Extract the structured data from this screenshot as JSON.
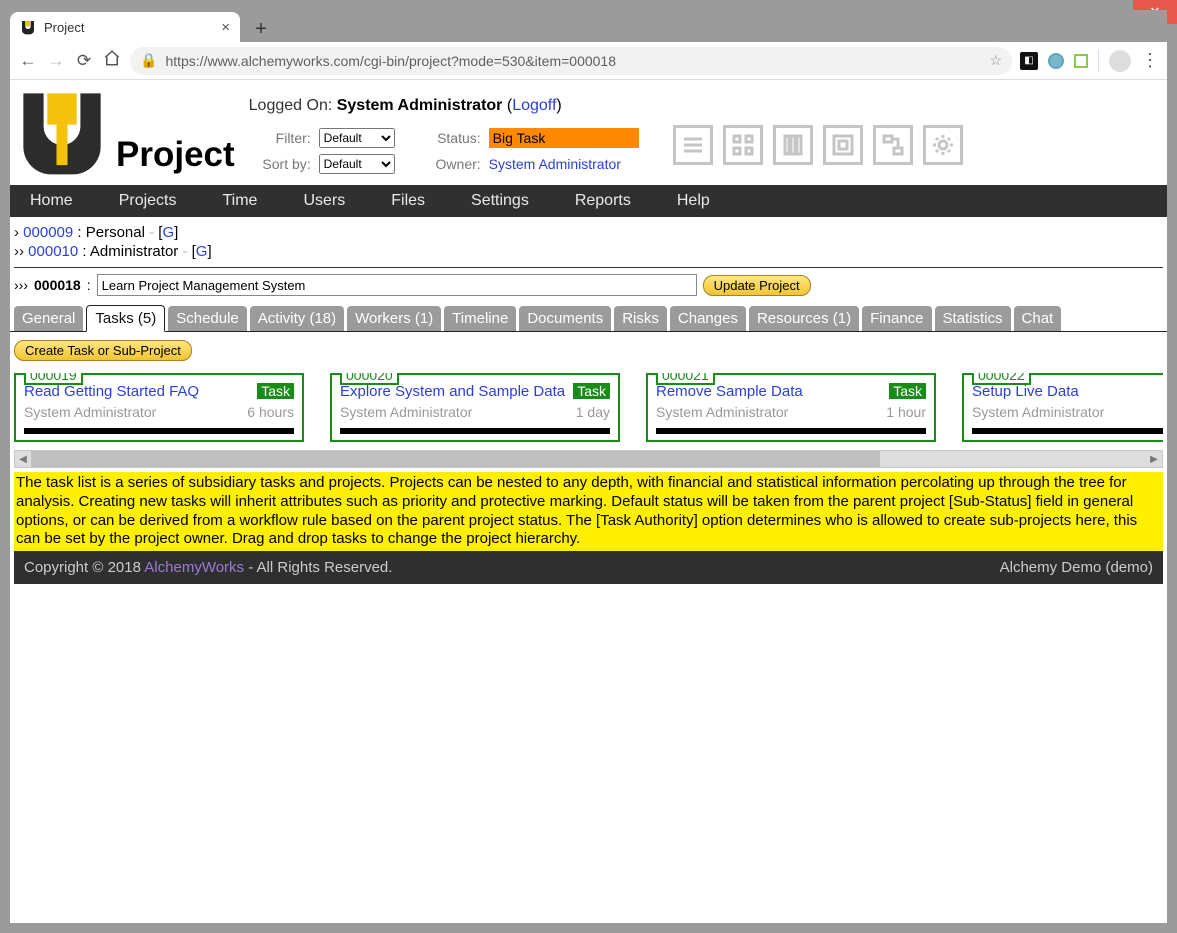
{
  "browser": {
    "tab_title": "Project",
    "url": "https://www.alchemyworks.com/cgi-bin/project?mode=530&item=000018"
  },
  "header": {
    "app_title": "Project",
    "logged_on_label": "Logged On:",
    "logged_on_user": "System Administrator",
    "logoff": "Logoff",
    "filter_label": "Filter:",
    "filter_value": "Default",
    "sortby_label": "Sort by:",
    "sortby_value": "Default",
    "status_label": "Status:",
    "status_value": "Big Task",
    "owner_label": "Owner:",
    "owner_value": "System Administrator"
  },
  "nav": [
    "Home",
    "Projects",
    "Time",
    "Users",
    "Files",
    "Settings",
    "Reports",
    "Help"
  ],
  "breadcrumbs": {
    "rows": [
      {
        "chev": "›",
        "id": "000009",
        "name": "Personal",
        "g": "G"
      },
      {
        "chev": "››",
        "id": "000010",
        "name": "Administrator",
        "g": "G"
      }
    ]
  },
  "project": {
    "chev": "›››",
    "id": "000018",
    "name": "Learn Project Management System",
    "update_label": "Update Project"
  },
  "tabs": [
    "General",
    "Tasks (5)",
    "Schedule",
    "Activity (18)",
    "Workers (1)",
    "Timeline",
    "Documents",
    "Risks",
    "Changes",
    "Resources (1)",
    "Finance",
    "Statistics",
    "Chat"
  ],
  "active_tab_index": 1,
  "create_task_label": "Create Task or Sub-Project",
  "tasks": [
    {
      "num": "000019",
      "title": "Read Getting Started FAQ",
      "badge": "Task",
      "owner": "System Administrator",
      "time": "6 hours"
    },
    {
      "num": "000020",
      "title": "Explore System and Sample Data",
      "badge": "Task",
      "owner": "System Administrator",
      "time": "1 day"
    },
    {
      "num": "000021",
      "title": "Remove Sample Data",
      "badge": "Task",
      "owner": "System Administrator",
      "time": "1 hour"
    },
    {
      "num": "000022",
      "title": "Setup Live Data",
      "badge": "",
      "owner": "System Administrator",
      "time": ""
    }
  ],
  "help_text": "The task list is a series of subsidiary tasks and projects. Projects can be nested to any depth, with financial and statistical information percolating up through the tree for analysis. Creating new tasks will inherit attributes such as priority and protective marking. Default status will be taken from the parent project [Sub-Status] field in general options, or can be derived from a workflow rule based on the parent project status. The [Task Authority] option determines who is allowed to create sub-projects here, this can be set by the project owner. Drag and drop tasks to change the project hierarchy.",
  "footer": {
    "copyright": "Copyright © 2018 ",
    "company": "AlchemyWorks",
    "rights": " - All Rights Reserved.",
    "right": "Alchemy Demo (demo)"
  }
}
